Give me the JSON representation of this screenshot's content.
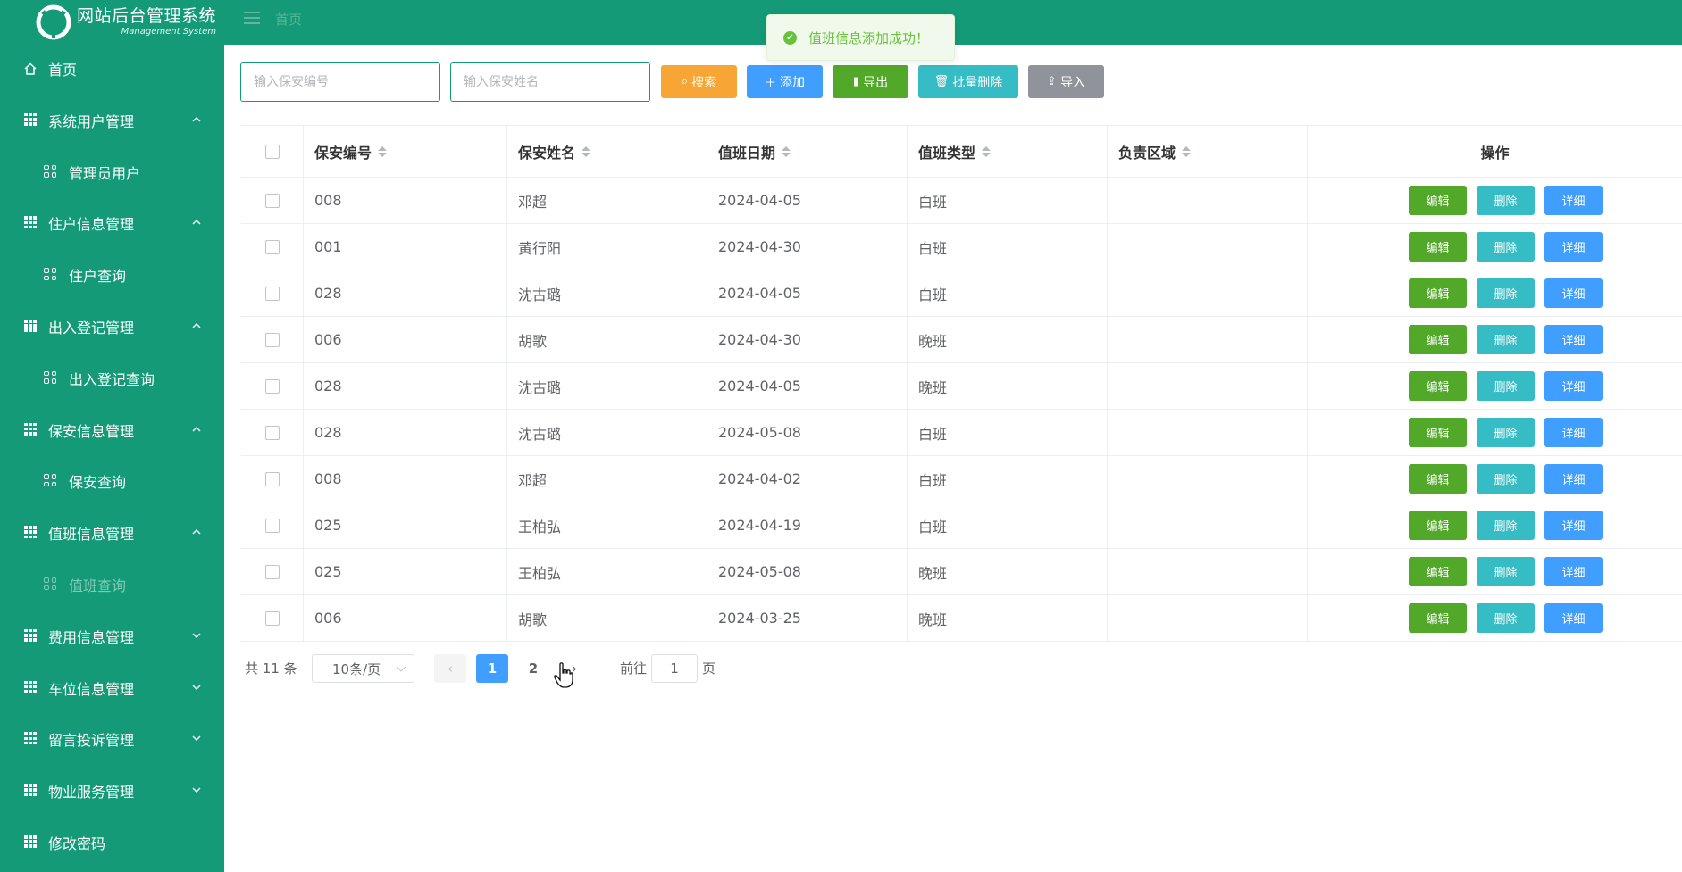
{
  "header": {
    "logo_title": "网站后台管理系统",
    "logo_subtitle": "Management System",
    "breadcrumb": "首页"
  },
  "toast": {
    "message": "值班信息添加成功！",
    "icon": "success-check-icon"
  },
  "sidebar": {
    "items": [
      {
        "label": "首页",
        "icon": "home-icon",
        "type": "top"
      },
      {
        "label": "系统用户管理",
        "icon": "grid-icon",
        "type": "group",
        "expanded": true
      },
      {
        "label": "管理员用户",
        "icon": "apps-icon",
        "type": "sub"
      },
      {
        "label": "住户信息管理",
        "icon": "grid-icon",
        "type": "group",
        "expanded": true
      },
      {
        "label": "住户查询",
        "icon": "apps-icon",
        "type": "sub"
      },
      {
        "label": "出入登记管理",
        "icon": "grid-icon",
        "type": "group",
        "expanded": true
      },
      {
        "label": "出入登记查询",
        "icon": "apps-icon",
        "type": "sub"
      },
      {
        "label": "保安信息管理",
        "icon": "grid-icon",
        "type": "group",
        "expanded": true
      },
      {
        "label": "保安查询",
        "icon": "apps-icon",
        "type": "sub"
      },
      {
        "label": "值班信息管理",
        "icon": "grid-icon",
        "type": "group",
        "expanded": true
      },
      {
        "label": "值班查询",
        "icon": "apps-icon",
        "type": "sub",
        "active": true
      },
      {
        "label": "费用信息管理",
        "icon": "grid-icon",
        "type": "group",
        "expanded": false
      },
      {
        "label": "车位信息管理",
        "icon": "grid-icon",
        "type": "group",
        "expanded": false
      },
      {
        "label": "留言投诉管理",
        "icon": "grid-icon",
        "type": "group",
        "expanded": false
      },
      {
        "label": "物业服务管理",
        "icon": "grid-icon",
        "type": "group",
        "expanded": false
      },
      {
        "label": "修改密码",
        "icon": "grid-icon",
        "type": "top"
      }
    ]
  },
  "search": {
    "id_placeholder": "输入保安编号",
    "name_placeholder": "输入保安姓名"
  },
  "toolbar": {
    "search_label": "搜索",
    "add_label": "添加",
    "export_label": "导出",
    "batch_delete_label": "批量删除",
    "import_label": "导入",
    "colors": {
      "search": "#f7a635",
      "add": "#409eff",
      "export": "#52a829",
      "batch_delete": "#35bcc4",
      "import": "#909399"
    }
  },
  "table": {
    "columns": [
      "保安编号",
      "保安姓名",
      "值班日期",
      "值班类型",
      "负责区域",
      "操作"
    ],
    "rows": [
      [
        "008",
        "邓超",
        "2024-04-05",
        "白班",
        ""
      ],
      [
        "001",
        "黄行阳",
        "2024-04-30",
        "白班",
        ""
      ],
      [
        "028",
        "沈古璐",
        "2024-04-05",
        "白班",
        ""
      ],
      [
        "006",
        "胡歌",
        "2024-04-30",
        "晚班",
        ""
      ],
      [
        "028",
        "沈古璐",
        "2024-04-05",
        "晚班",
        ""
      ],
      [
        "028",
        "沈古璐",
        "2024-05-08",
        "白班",
        ""
      ],
      [
        "008",
        "邓超",
        "2024-04-02",
        "白班",
        ""
      ],
      [
        "025",
        "王柏弘",
        "2024-04-19",
        "白班",
        ""
      ],
      [
        "025",
        "王柏弘",
        "2024-05-08",
        "晚班",
        ""
      ],
      [
        "006",
        "胡歌",
        "2024-03-25",
        "晚班",
        ""
      ]
    ],
    "actions": {
      "edit": "编辑",
      "delete": "删除",
      "detail": "详细"
    },
    "action_colors": {
      "edit": "#52a829",
      "delete": "#35bcc4",
      "detail": "#409eff"
    }
  },
  "pagination": {
    "total_text": "共 11 条",
    "page_size": "10条/页",
    "pages": [
      "1",
      "2"
    ],
    "current_page": "1",
    "goto_prefix": "前往",
    "goto_value": "1",
    "goto_suffix": "页"
  }
}
